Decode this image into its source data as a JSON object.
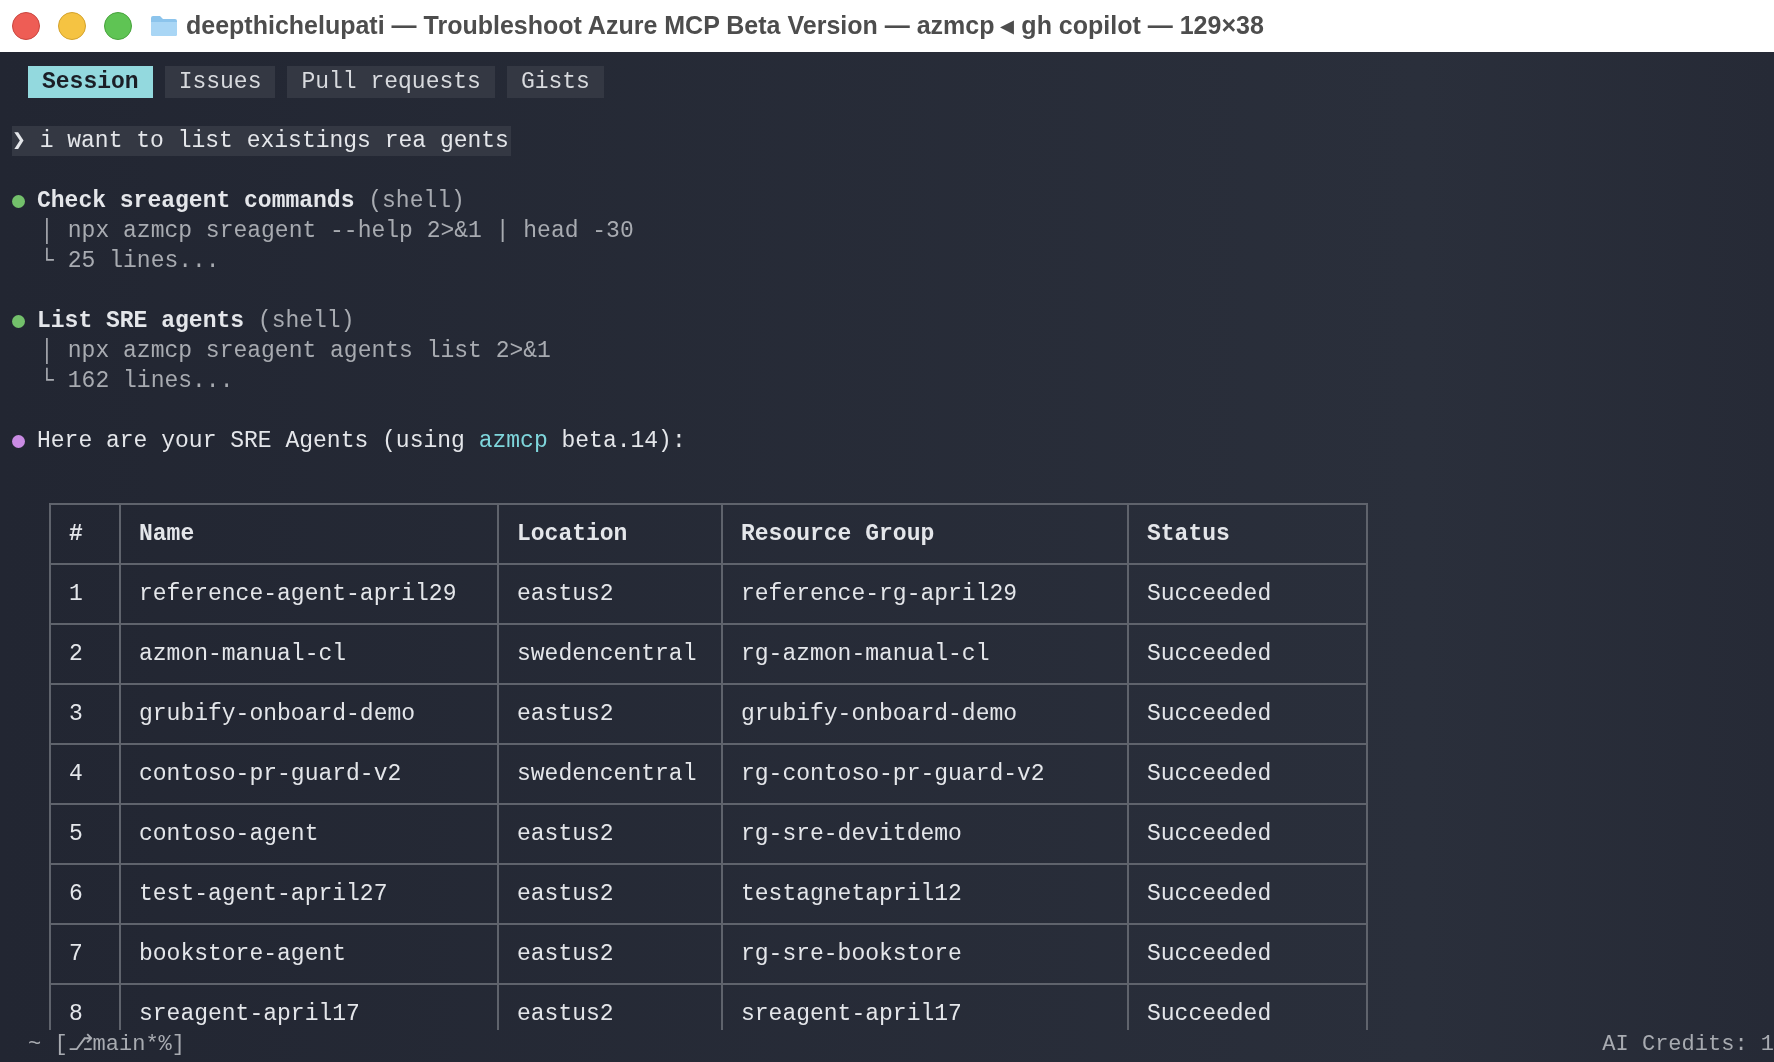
{
  "window": {
    "title": "deepthichelupati — Troubleshoot Azure MCP Beta Version — azmcp ◂ gh copilot — 129×38"
  },
  "tabs": [
    {
      "label": "Session",
      "selected": true
    },
    {
      "label": "Issues",
      "selected": false
    },
    {
      "label": "Pull requests",
      "selected": false
    },
    {
      "label": "Gists",
      "selected": false
    }
  ],
  "prompt": {
    "marker": "❯",
    "text": "i want to list existings rea gents"
  },
  "steps": [
    {
      "color": "#73c06b",
      "title": "Check sreagent commands",
      "tag": "(shell)",
      "command_mark": "│",
      "command": "npx azmcp sreagent --help 2>&1 | head -30",
      "result_mark": "└",
      "result": "25 lines..."
    },
    {
      "color": "#73c06b",
      "title": "List SRE agents",
      "tag": "(shell)",
      "command_mark": "│",
      "command": "npx azmcp sreagent agents list 2>&1",
      "result_mark": "└",
      "result": "162 lines..."
    }
  ],
  "message": {
    "color": "#c98be3",
    "parts": [
      {
        "kind": "plain",
        "text": "Here are your SRE Agents (using "
      },
      {
        "kind": "code",
        "text": "azmcp"
      },
      {
        "kind": "plain",
        "text": " beta.14):"
      }
    ]
  },
  "table": {
    "columns": [
      "#",
      "Name",
      "Location",
      "Resource Group",
      "Status"
    ],
    "rows": [
      [
        "1",
        "reference-agent-april29",
        "eastus2",
        "reference-rg-april29",
        "Succeeded"
      ],
      [
        "2",
        "azmon-manual-cl",
        "swedencentral",
        "rg-azmon-manual-cl",
        "Succeeded"
      ],
      [
        "3",
        "grubify-onboard-demo",
        "eastus2",
        "grubify-onboard-demo",
        "Succeeded"
      ],
      [
        "4",
        "contoso-pr-guard-v2",
        "swedencentral",
        "rg-contoso-pr-guard-v2",
        "Succeeded"
      ],
      [
        "5",
        "contoso-agent",
        "eastus2",
        "rg-sre-devitdemo",
        "Succeeded"
      ],
      [
        "6",
        "test-agent-april27",
        "eastus2",
        "testagnetapril12",
        "Succeeded"
      ],
      [
        "7",
        "bookstore-agent",
        "eastus2",
        "rg-sre-bookstore",
        "Succeeded"
      ],
      [
        "8",
        "sreagent-april17",
        "eastus2",
        "sreagent-april17",
        "Succeeded"
      ]
    ]
  },
  "status_bar": {
    "left": "~ [⎇main*%]",
    "right": "AI Credits: 1"
  }
}
